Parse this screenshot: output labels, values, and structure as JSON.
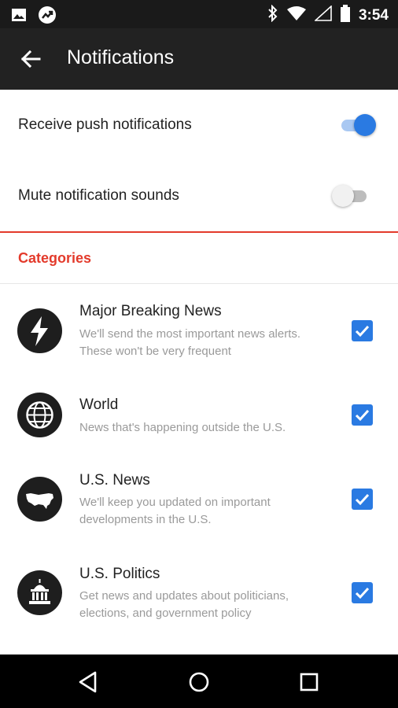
{
  "status_bar": {
    "time": "3:54",
    "icons": [
      "image-icon",
      "trending-icon",
      "bluetooth-icon",
      "wifi-icon",
      "cell-signal-icon",
      "battery-icon"
    ]
  },
  "app_bar": {
    "title": "Notifications",
    "back_icon": "arrow-left-icon"
  },
  "settings": [
    {
      "label": "Receive push notifications",
      "enabled": true
    },
    {
      "label": "Mute notification sounds",
      "enabled": false
    }
  ],
  "categories_header": "Categories",
  "categories": [
    {
      "title": "Major Breaking News",
      "description": "We'll send the most important news alerts. These won't be very frequent",
      "icon": "lightning-bolt-icon",
      "checked": true
    },
    {
      "title": "World",
      "description": "News that's happening outside the U.S.",
      "icon": "globe-icon",
      "checked": true
    },
    {
      "title": "U.S. News",
      "description": "We'll keep you updated on important developments in the U.S.",
      "icon": "us-map-icon",
      "checked": true
    },
    {
      "title": "U.S. Politics",
      "description": "Get news and updates about politicians, elections, and government policy",
      "icon": "capitol-icon",
      "checked": true
    }
  ],
  "nav_bar": {
    "icons": [
      "back-triangle-icon",
      "home-circle-icon",
      "recents-square-icon"
    ]
  },
  "colors": {
    "app_bar": "#222222",
    "accent_red": "#e33a2b",
    "accent_blue": "#2a7ae2",
    "toggle_track_on": "#a9c8f2",
    "toggle_off_thumb": "#f1f1f1",
    "toggle_off_track": "#bdbdbd"
  }
}
